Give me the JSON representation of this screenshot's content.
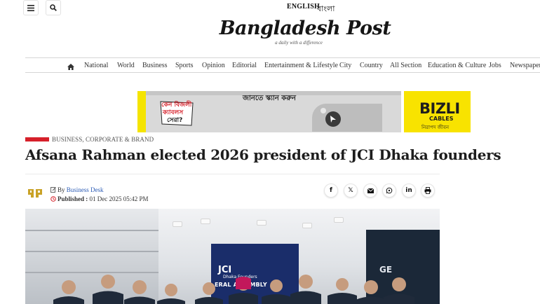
{
  "header": {
    "languages": [
      "ENGLISH",
      "বাংলা"
    ],
    "logo_text": "Bangladesh Post",
    "tagline": "a daily with a difference"
  },
  "nav": {
    "items": [
      "National",
      "World",
      "Business",
      "Sports",
      "Opinion",
      "Editorial",
      "Entertainment & Lifestyle",
      "City",
      "Country",
      "All Section",
      "Education & Culture",
      "Jobs",
      "Newspaper"
    ]
  },
  "ad": {
    "badge_lines": [
      "কেন বিজলী",
      "ক্যাবলস",
      "সেরা?"
    ],
    "headline": "জানতে স্ক্যান করুন",
    "brand": "BIZLI",
    "brand_sub": "CABLES",
    "brand_bn": "নিরাপদ জীবন"
  },
  "article": {
    "category": "BUSINESS, CORPORATE & BRAND",
    "title": "Afsana Rahman elected 2026 president of JCI Dhaka founders",
    "by_prefix": "By",
    "author": "Business Desk",
    "published_label": "Published :",
    "published_date": "01 Dec 2025 05:42 PM"
  },
  "photo": {
    "banner_title": "JCI",
    "banner_sub": "Dhaka Founders",
    "banner_line": "ERAL ASSEMBLY",
    "screen_text": "GE"
  },
  "share": [
    "facebook-icon",
    "x-icon",
    "email-icon",
    "whatsapp-icon",
    "linkedin-icon",
    "print-icon"
  ],
  "colors": {
    "accent": "#d6202a",
    "link": "#2b5bb5",
    "ad_yellow": "#f8e300"
  }
}
